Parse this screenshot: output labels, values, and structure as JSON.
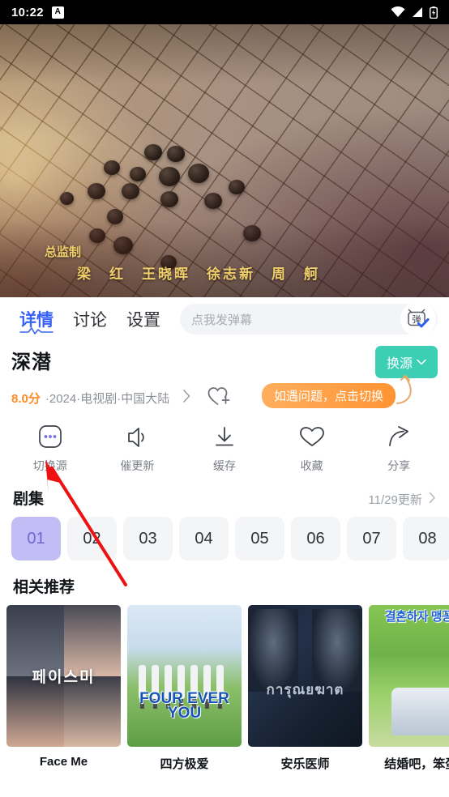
{
  "statusbar": {
    "time": "10:22",
    "badge": "A",
    "icons": [
      "wifi-icon",
      "signal-icon",
      "battery-icon"
    ]
  },
  "video": {
    "credit_role": "总监制",
    "credit_names": "梁　红　王晓晖　徐志新　周　舸"
  },
  "tabs": [
    {
      "label": "详情",
      "active": true
    },
    {
      "label": "讨论",
      "active": false
    },
    {
      "label": "设置",
      "active": false
    }
  ],
  "danmaku": {
    "placeholder": "点我发弹幕",
    "value": "",
    "toggle_label": "弹"
  },
  "detail": {
    "title": "深潜",
    "rating": "8.0分",
    "meta": "·2024·电视剧·中国大陆",
    "switch_source_label": "换源",
    "tooltip": "如遇问题，点击切换"
  },
  "actions": [
    {
      "label": "切换源",
      "icon": "more-dots-icon"
    },
    {
      "label": "催更新",
      "icon": "speaker-icon"
    },
    {
      "label": "缓存",
      "icon": "download-icon"
    },
    {
      "label": "收藏",
      "icon": "heart-icon"
    },
    {
      "label": "分享",
      "icon": "share-icon"
    }
  ],
  "episodes": {
    "section_title": "剧集",
    "update_label": "11/29更新",
    "selected": "01",
    "items": [
      "01",
      "02",
      "03",
      "04",
      "05",
      "06",
      "07",
      "08"
    ]
  },
  "recommend": {
    "section_title": "相关推荐",
    "items": [
      {
        "title": "Face Me",
        "poster_text": "페이스미"
      },
      {
        "title": "四方极爱",
        "poster_text": "FOUR EVER YOU"
      },
      {
        "title": "安乐医师",
        "poster_text": "การุณยฆาต"
      },
      {
        "title": "结婚吧，笨蛋...",
        "poster_text": "결혼하자 맹꽁아!"
      }
    ]
  },
  "colors": {
    "accent_blue": "#3a63f5",
    "teal": "#3ccfb4",
    "orange": "#ff8a23",
    "purple": "#c3bdf5",
    "purple_text": "#6f65d6"
  }
}
